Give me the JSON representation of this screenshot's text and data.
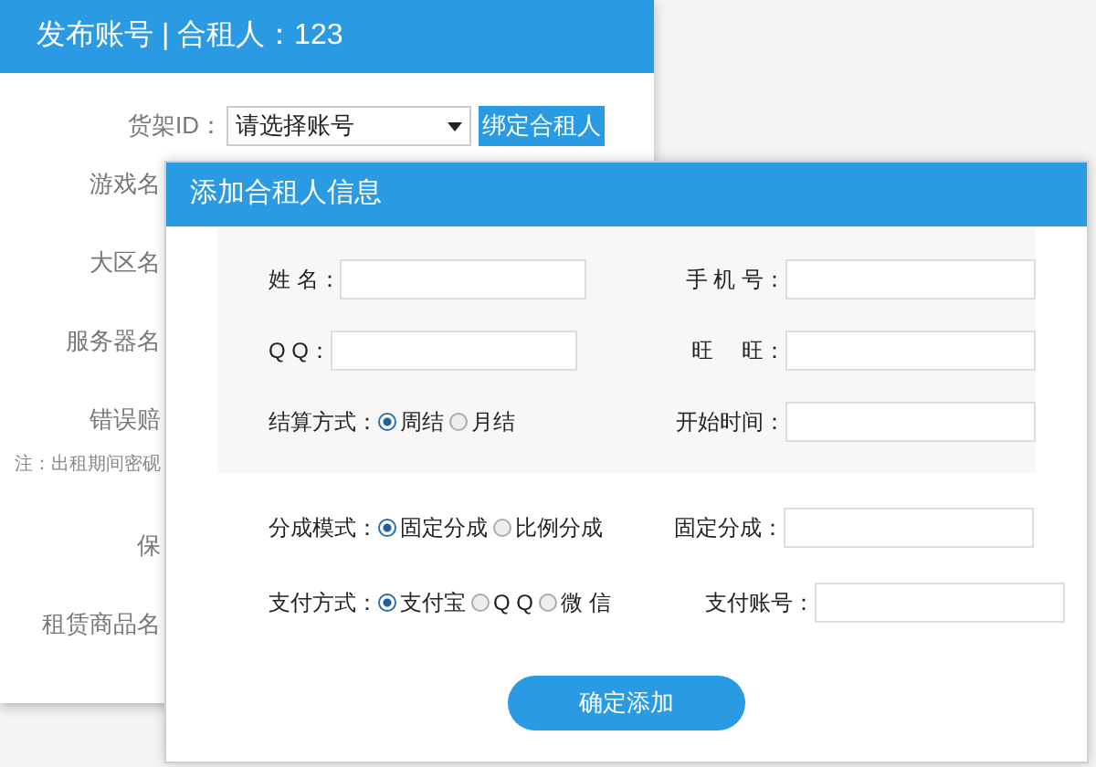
{
  "page": {
    "title": "发布账号 | 合租人：123",
    "shelf": {
      "label": "货架ID：",
      "select_value": "请选择账号",
      "bind_button": "绑定合租人"
    },
    "labels": [
      {
        "kind": "label",
        "text": "游戏名"
      },
      {
        "kind": "label",
        "text": "大区名"
      },
      {
        "kind": "label",
        "text": "服务器名"
      },
      {
        "kind": "label",
        "text": "错误赔"
      },
      {
        "kind": "note",
        "text": "注：出租期间密砚"
      },
      {
        "kind": "label",
        "text": "保"
      },
      {
        "kind": "label",
        "text": "租赁商品名"
      }
    ]
  },
  "dialog": {
    "title": "添加合租人信息",
    "basic_rows": [
      {
        "fields": [
          {
            "label": "姓 名：",
            "kind": "input"
          },
          {
            "label": "手 机 号：",
            "kind": "input"
          }
        ]
      },
      {
        "fields": [
          {
            "label": "Q Q：",
            "kind": "input"
          },
          {
            "label": "旺　 旺：",
            "kind": "input"
          }
        ]
      },
      {
        "fields": [
          {
            "label": "结算方式：",
            "kind": "radio",
            "options": [
              {
                "label": "周结",
                "selected": true
              },
              {
                "label": "月结",
                "selected": false
              }
            ]
          },
          {
            "label": "开始时间：",
            "kind": "input"
          }
        ]
      }
    ],
    "extra_rows": [
      {
        "fields": [
          {
            "label": "分成模式：",
            "kind": "radio",
            "options": [
              {
                "label": "固定分成",
                "selected": true
              },
              {
                "label": "比例分成",
                "selected": false
              }
            ]
          },
          {
            "label": "固定分成：",
            "kind": "input"
          }
        ]
      },
      {
        "fields": [
          {
            "label": "支付方式：",
            "kind": "radio",
            "options": [
              {
                "label": "支付宝",
                "selected": true
              },
              {
                "label": "Q Q",
                "selected": false
              },
              {
                "label": "微 信",
                "selected": false
              }
            ]
          },
          {
            "label": "支付账号：",
            "kind": "input"
          }
        ]
      }
    ],
    "submit": "确定添加"
  }
}
